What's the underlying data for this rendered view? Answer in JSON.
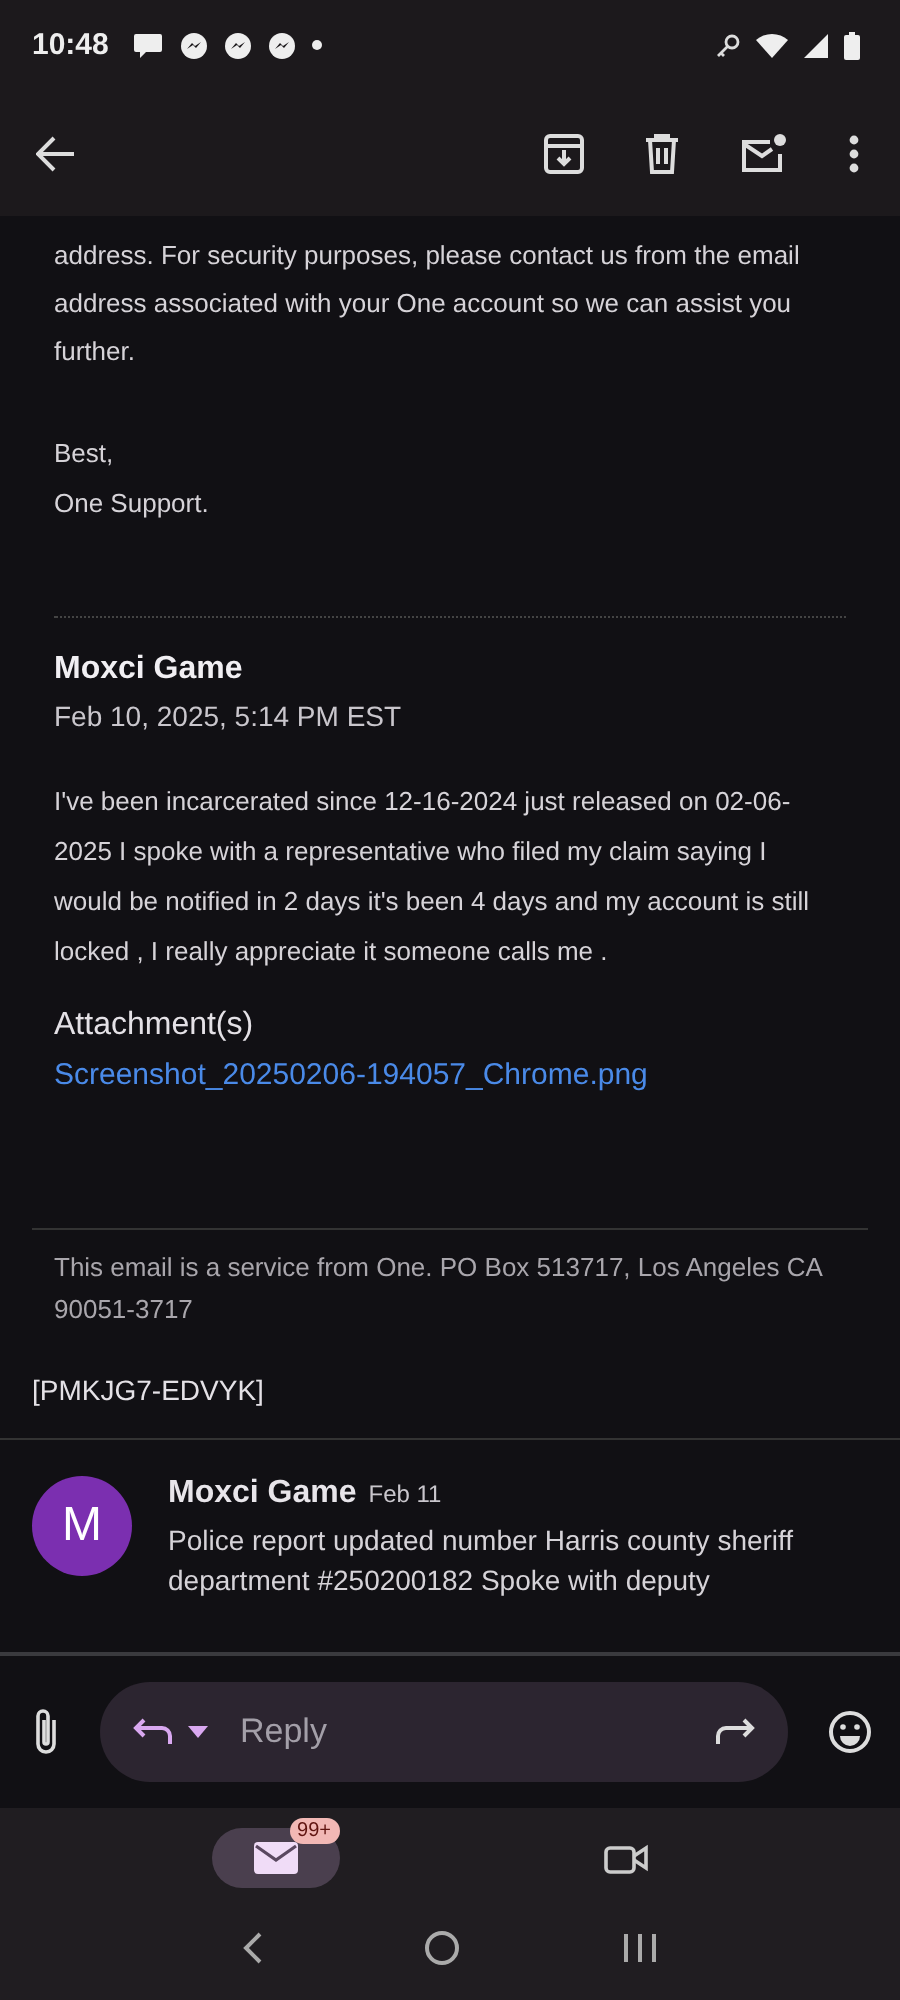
{
  "status_bar": {
    "time": "10:48"
  },
  "previous_message": {
    "body": "address. For security purposes, please contact us from the email address associated with your One account so we can assist you further.",
    "closing": [
      "Best,",
      "One Support."
    ]
  },
  "message": {
    "sender": "Moxci Game",
    "date": "Feb 10, 2025, 5:14 PM EST",
    "body": "I've been incarcerated since 12-16-2024 just released on 02-06-2025 I spoke with a representative who filed my claim saying I would be notified in 2 days it's been 4 days and my account is still locked , I really appreciate it someone calls me .",
    "attachments_label": "Attachment(s)",
    "attachments": [
      "Screenshot_20250206-194057_Chrome.png"
    ],
    "footer": "This email is a service from One. PO Box 513717, Los Angeles CA 90051-3717",
    "reference": "[PMKJG7-EDVYK]"
  },
  "collapsed_message": {
    "avatar_letter": "M",
    "color": "#7b2fb0",
    "sender": "Moxci Game",
    "date": "Feb 11",
    "snippet": "Police report updated number Harris county sheriff department #250200182 Spoke with deputy"
  },
  "reply_bar": {
    "placeholder": "Reply"
  },
  "bottom_nav": [
    {
      "kind": "mail",
      "selected": true,
      "badge": "99+"
    },
    {
      "kind": "meet",
      "selected": false
    }
  ]
}
